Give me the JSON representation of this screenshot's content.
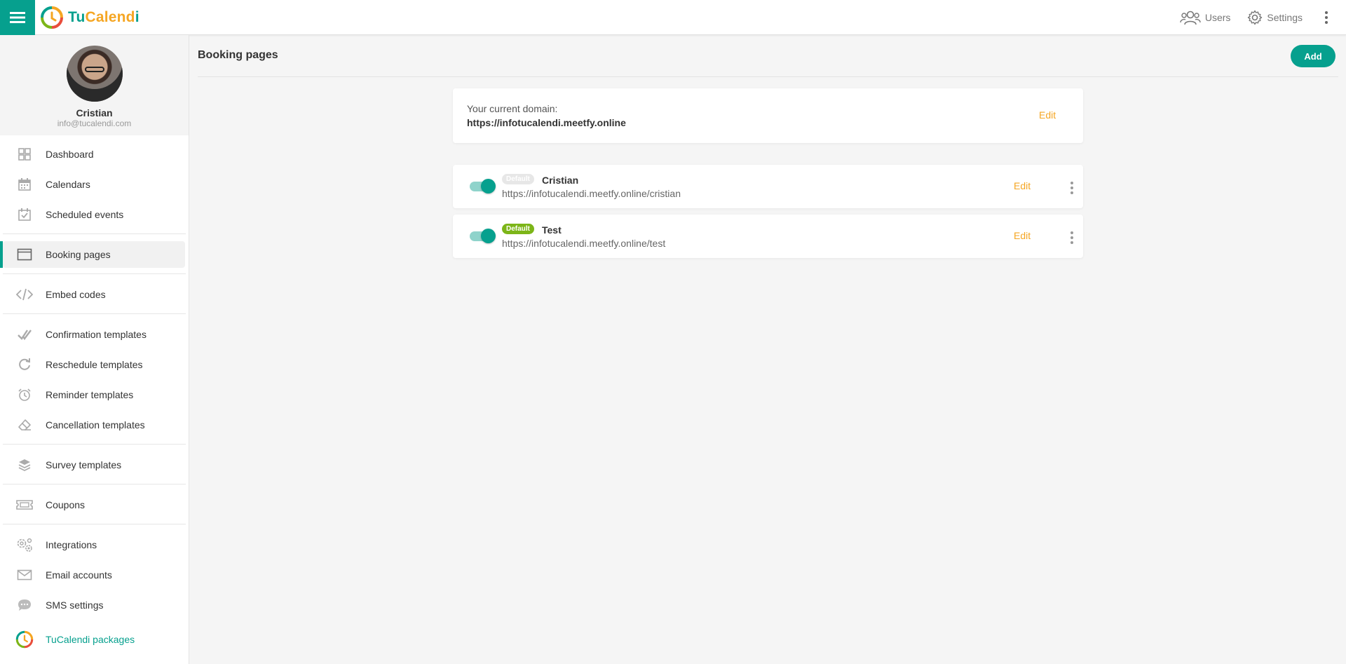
{
  "app": {
    "logo_part1": "Tu",
    "logo_part2": "Calend",
    "logo_part3": "i"
  },
  "topbar": {
    "users_label": "Users",
    "settings_label": "Settings"
  },
  "profile": {
    "name": "Cristian",
    "email": "info@tucalendi.com"
  },
  "sidebar": {
    "items": [
      {
        "label": "Dashboard",
        "icon": "dashboard-icon"
      },
      {
        "label": "Calendars",
        "icon": "calendar-icon"
      },
      {
        "label": "Scheduled events",
        "icon": "calendar-check-icon"
      },
      {
        "label": "Booking pages",
        "icon": "browser-window-icon",
        "active": true
      },
      {
        "label": "Embed codes",
        "icon": "code-icon"
      },
      {
        "label": "Confirmation templates",
        "icon": "double-check-icon"
      },
      {
        "label": "Reschedule templates",
        "icon": "refresh-icon"
      },
      {
        "label": "Reminder templates",
        "icon": "alarm-clock-icon"
      },
      {
        "label": "Cancellation templates",
        "icon": "eraser-icon"
      },
      {
        "label": "Survey templates",
        "icon": "layers-icon"
      },
      {
        "label": "Coupons",
        "icon": "ticket-icon"
      },
      {
        "label": "Integrations",
        "icon": "gears-icon"
      },
      {
        "label": "Email accounts",
        "icon": "envelope-icon"
      },
      {
        "label": "SMS settings",
        "icon": "chat-bubble-icon"
      },
      {
        "label": "TuCalendi packages",
        "icon": "tucalendi-logo-icon"
      }
    ]
  },
  "main": {
    "title": "Booking pages",
    "add_label": "Add",
    "domain": {
      "label": "Your current domain:",
      "value": "https://infotucalendi.meetfy.online",
      "edit_label": "Edit"
    },
    "pages": [
      {
        "name": "Cristian",
        "url": "https://infotucalendi.meetfy.online/cristian",
        "badge": "Default",
        "is_default": false,
        "enabled": true,
        "edit_label": "Edit"
      },
      {
        "name": "Test",
        "url": "https://infotucalendi.meetfy.online/test",
        "badge": "Default",
        "is_default": true,
        "enabled": true,
        "edit_label": "Edit"
      }
    ]
  },
  "colors": {
    "brand_teal": "#06a08e",
    "brand_orange": "#f5a623",
    "default_badge_green": "#7cb518"
  }
}
